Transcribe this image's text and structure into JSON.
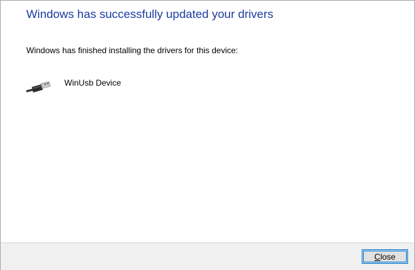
{
  "dialog": {
    "title": "Windows has successfully updated your drivers",
    "message": "Windows has finished installing the drivers for this device:",
    "device": {
      "icon": "usb-plug-icon",
      "name": "WinUsb Device"
    }
  },
  "footer": {
    "close_label_mnemonic": "C",
    "close_label_rest": "lose"
  },
  "colors": {
    "title": "#1a3aa0",
    "footer_background": "#f0f0f0",
    "button_focus_border": "#0078d7"
  }
}
